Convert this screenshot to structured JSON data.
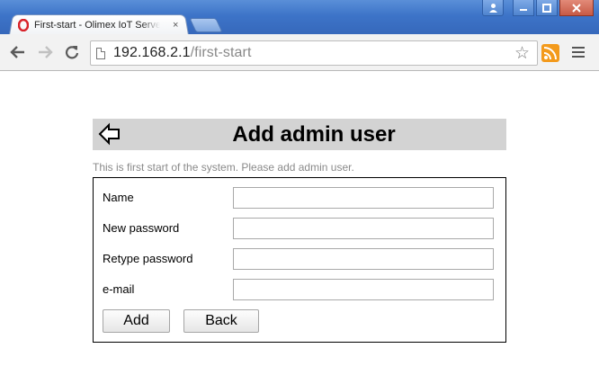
{
  "browser": {
    "tab_title": "First-start - Olimex IoT Server",
    "tab_close_label": "×",
    "window_buttons": [
      "user",
      "minimize",
      "maximize",
      "close"
    ],
    "url_host": "192.168.2.1",
    "url_path": "/first-start"
  },
  "page": {
    "title": "Add admin user",
    "subtitle": "This is first start of the system. Please add admin user.",
    "fields": [
      {
        "label": "Name",
        "value": ""
      },
      {
        "label": "New password",
        "value": ""
      },
      {
        "label": "Retype password",
        "value": ""
      },
      {
        "label": "e-mail",
        "value": ""
      }
    ],
    "add_label": "Add",
    "back_label": "Back"
  },
  "colors": {
    "header_band": "#d3d3d3",
    "subtitle_text": "#8a8a8a",
    "titlebar": "#3d74c8",
    "rss": "#f39a1c"
  }
}
